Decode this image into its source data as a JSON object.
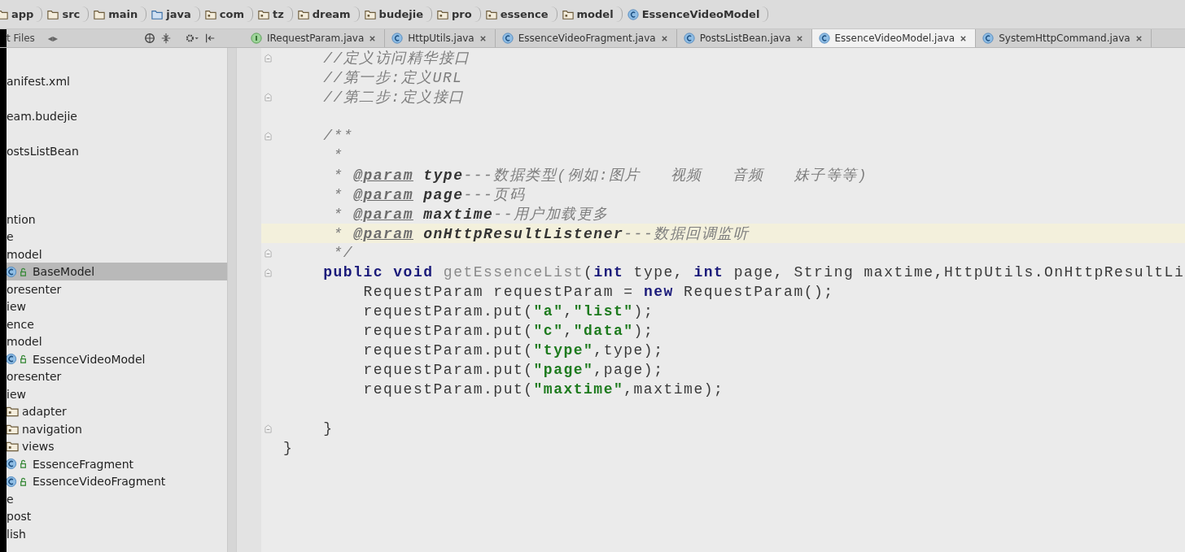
{
  "breadcrumbs": [
    {
      "label": "app",
      "kind": "module"
    },
    {
      "label": "src",
      "kind": "folder"
    },
    {
      "label": "main",
      "kind": "folder"
    },
    {
      "label": "java",
      "kind": "source"
    },
    {
      "label": "com",
      "kind": "package"
    },
    {
      "label": "tz",
      "kind": "package"
    },
    {
      "label": "dream",
      "kind": "package"
    },
    {
      "label": "budejie",
      "kind": "package"
    },
    {
      "label": "pro",
      "kind": "package"
    },
    {
      "label": "essence",
      "kind": "package"
    },
    {
      "label": "model",
      "kind": "package"
    },
    {
      "label": "EssenceVideoModel",
      "kind": "class"
    }
  ],
  "project_panel": {
    "title": "t Files",
    "arrows": "◂▸",
    "tree": [
      {
        "label": "anifest.xml",
        "kind": "text",
        "selected": false
      },
      {
        "label": "eam.budejie",
        "kind": "text",
        "selected": false
      },
      {
        "label": "ostsListBean",
        "kind": "text",
        "selected": false
      },
      {
        "label": "ntion",
        "kind": "text",
        "selected": false
      },
      {
        "label": "e",
        "kind": "text",
        "selected": false
      },
      {
        "label": "model",
        "kind": "text",
        "selected": false
      },
      {
        "label": "BaseModel",
        "kind": "class",
        "selected": true
      },
      {
        "label": "oresenter",
        "kind": "text",
        "selected": false
      },
      {
        "label": "iew",
        "kind": "text",
        "selected": false
      },
      {
        "label": "ence",
        "kind": "text",
        "selected": false
      },
      {
        "label": "model",
        "kind": "text",
        "selected": false
      },
      {
        "label": "EssenceVideoModel",
        "kind": "class",
        "selected": false
      },
      {
        "label": "oresenter",
        "kind": "text",
        "selected": false
      },
      {
        "label": "iew",
        "kind": "text",
        "selected": false
      },
      {
        "label": "adapter",
        "kind": "package",
        "selected": false
      },
      {
        "label": "navigation",
        "kind": "package",
        "selected": false
      },
      {
        "label": "views",
        "kind": "package",
        "selected": false
      },
      {
        "label": "EssenceFragment",
        "kind": "class",
        "selected": false
      },
      {
        "label": "EssenceVideoFragment",
        "kind": "class",
        "selected": false
      },
      {
        "label": "e",
        "kind": "text",
        "selected": false
      },
      {
        "label": "post",
        "kind": "text",
        "selected": false
      },
      {
        "label": "lish",
        "kind": "text",
        "selected": false
      }
    ]
  },
  "tabs": [
    {
      "label": "IRequestParam.java",
      "kind": "interface",
      "selected": false
    },
    {
      "label": "HttpUtils.java",
      "kind": "class",
      "selected": false
    },
    {
      "label": "EssenceVideoFragment.java",
      "kind": "class",
      "selected": false
    },
    {
      "label": "PostsListBean.java",
      "kind": "class",
      "selected": false
    },
    {
      "label": "EssenceVideoModel.java",
      "kind": "class",
      "selected": true
    },
    {
      "label": "SystemHttpCommand.java",
      "kind": "class",
      "selected": false
    }
  ],
  "editor": {
    "lines": [
      {
        "kind": "code",
        "fold": true,
        "current": false,
        "tokens": [
          {
            "text": "    //定义访问精华接口",
            "kind": "comment"
          }
        ]
      },
      {
        "kind": "code",
        "fold": false,
        "current": false,
        "tokens": [
          {
            "text": "    //第一步:定义URL",
            "kind": "comment"
          }
        ]
      },
      {
        "kind": "code",
        "fold": true,
        "current": false,
        "tokens": [
          {
            "text": "    //第二步:定义接口",
            "kind": "comment"
          }
        ]
      },
      {
        "kind": "blank",
        "fold": false,
        "current": false
      },
      {
        "kind": "code",
        "fold": true,
        "current": false,
        "tokens": [
          {
            "text": "    /**",
            "kind": "comment"
          }
        ]
      },
      {
        "kind": "code",
        "fold": false,
        "current": false,
        "tokens": [
          {
            "text": "     *",
            "kind": "comment"
          }
        ]
      },
      {
        "kind": "code",
        "fold": false,
        "current": false,
        "tokens": [
          {
            "text": "     * ",
            "kind": "comment"
          },
          {
            "text": "@param",
            "kind": "tag"
          },
          {
            "text": " type",
            "kind": "param"
          },
          {
            "text": "---数据类型(例如:图片   视频   音频   妹子等等)",
            "kind": "comment"
          }
        ]
      },
      {
        "kind": "code",
        "fold": false,
        "current": false,
        "tokens": [
          {
            "text": "     * ",
            "kind": "comment"
          },
          {
            "text": "@param",
            "kind": "tag"
          },
          {
            "text": " page",
            "kind": "param"
          },
          {
            "text": "---页码",
            "kind": "comment"
          }
        ]
      },
      {
        "kind": "code",
        "fold": false,
        "current": false,
        "tokens": [
          {
            "text": "     * ",
            "kind": "comment"
          },
          {
            "text": "@param",
            "kind": "tag"
          },
          {
            "text": " maxtime",
            "kind": "param"
          },
          {
            "text": "--用户加载更多",
            "kind": "comment"
          }
        ]
      },
      {
        "kind": "code",
        "fold": false,
        "current": true,
        "tokens": [
          {
            "text": "     * ",
            "kind": "comment"
          },
          {
            "text": "@param",
            "kind": "tag"
          },
          {
            "text": " onHttpResultListener",
            "kind": "param"
          },
          {
            "text": "---数据回调监听",
            "kind": "comment"
          }
        ]
      },
      {
        "kind": "code",
        "fold": true,
        "current": false,
        "tokens": [
          {
            "text": "     */",
            "kind": "comment"
          }
        ]
      },
      {
        "kind": "code",
        "fold": true,
        "current": false,
        "tokens": [
          {
            "text": "    public void ",
            "kind": "keyword"
          },
          {
            "text": "getEssenceList",
            "kind": "unused"
          },
          {
            "text": "(",
            "kind": "plain"
          },
          {
            "text": "int ",
            "kind": "keyword"
          },
          {
            "text": "type, ",
            "kind": "plain"
          },
          {
            "text": "int ",
            "kind": "keyword"
          },
          {
            "text": "page, String maxtime,HttpUtils.OnHttpResultLi",
            "kind": "plain"
          }
        ]
      },
      {
        "kind": "code",
        "fold": false,
        "current": false,
        "tokens": [
          {
            "text": "        RequestParam requestParam = ",
            "kind": "plain"
          },
          {
            "text": "new ",
            "kind": "keyword"
          },
          {
            "text": "RequestParam();",
            "kind": "plain"
          }
        ]
      },
      {
        "kind": "code",
        "fold": false,
        "current": false,
        "tokens": [
          {
            "text": "        requestParam.put(",
            "kind": "plain"
          },
          {
            "text": "\"a\"",
            "kind": "string"
          },
          {
            "text": ",",
            "kind": "plain"
          },
          {
            "text": "\"list\"",
            "kind": "string"
          },
          {
            "text": ");",
            "kind": "plain"
          }
        ]
      },
      {
        "kind": "code",
        "fold": false,
        "current": false,
        "tokens": [
          {
            "text": "        requestParam.put(",
            "kind": "plain"
          },
          {
            "text": "\"c\"",
            "kind": "string"
          },
          {
            "text": ",",
            "kind": "plain"
          },
          {
            "text": "\"data\"",
            "kind": "string"
          },
          {
            "text": ");",
            "kind": "plain"
          }
        ]
      },
      {
        "kind": "code",
        "fold": false,
        "current": false,
        "tokens": [
          {
            "text": "        requestParam.put(",
            "kind": "plain"
          },
          {
            "text": "\"type\"",
            "kind": "string"
          },
          {
            "text": ",type);",
            "kind": "plain"
          }
        ]
      },
      {
        "kind": "code",
        "fold": false,
        "current": false,
        "tokens": [
          {
            "text": "        requestParam.put(",
            "kind": "plain"
          },
          {
            "text": "\"page\"",
            "kind": "string"
          },
          {
            "text": ",page);",
            "kind": "plain"
          }
        ]
      },
      {
        "kind": "code",
        "fold": false,
        "current": false,
        "tokens": [
          {
            "text": "        requestParam.put(",
            "kind": "plain"
          },
          {
            "text": "\"maxtime\"",
            "kind": "string"
          },
          {
            "text": ",maxtime);",
            "kind": "plain"
          }
        ]
      },
      {
        "kind": "blank",
        "fold": false,
        "current": false
      },
      {
        "kind": "code",
        "fold": true,
        "current": false,
        "tokens": [
          {
            "text": "    }",
            "kind": "plain"
          }
        ]
      },
      {
        "kind": "code",
        "fold": false,
        "current": false,
        "tokens": [
          {
            "text": "}",
            "kind": "plain"
          }
        ]
      }
    ]
  }
}
